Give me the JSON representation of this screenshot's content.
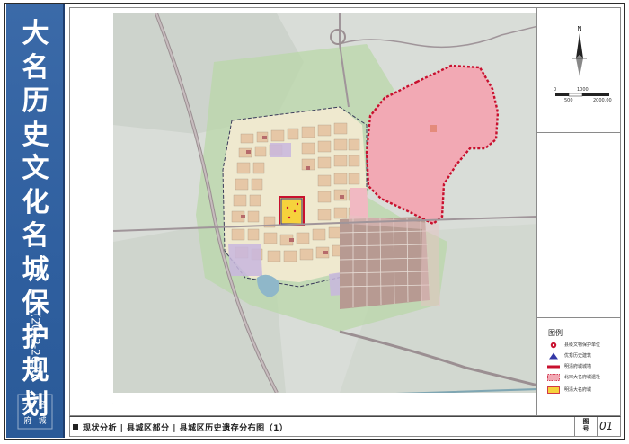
{
  "title_chars": [
    "大",
    "名",
    "历",
    "史",
    "文",
    "化",
    "名",
    "城",
    "保",
    "护",
    "规",
    "划"
  ],
  "years": "（2012-2030）",
  "logo_chars": [
    "大",
    "名",
    "府",
    "城"
  ],
  "north_label": "N",
  "scale": {
    "zero": "0",
    "mid_top": "1000",
    "mid_bottom": "500",
    "end": "2000.00"
  },
  "legend": {
    "title": "图例",
    "items": [
      {
        "label": "县级文物保护单位",
        "symbol": "red-circle-icon"
      },
      {
        "label": "优秀历史建筑",
        "symbol": "blue-triangle-icon"
      },
      {
        "label": "明清府城城墙",
        "symbol": "red-line-icon"
      },
      {
        "label": "北宋大名府城遗址",
        "symbol": "pink-rect-icon"
      },
      {
        "label": "明清大名府城",
        "symbol": "yellow-rect-icon"
      }
    ]
  },
  "caption": "现状分析 | 县城区部分 | 县城区历史遗存分布图（1）",
  "tuhao_chars": [
    "图",
    "号"
  ],
  "figure_number": "01",
  "colors": {
    "title_band": "#2f5f9f",
    "song_site_fill": "#f2a9b4",
    "song_site_border": "#c8102e",
    "ming_city_fill": "#f6d23c",
    "ming_wall": "#c8102e",
    "vegetation": "#cfe0c2"
  }
}
